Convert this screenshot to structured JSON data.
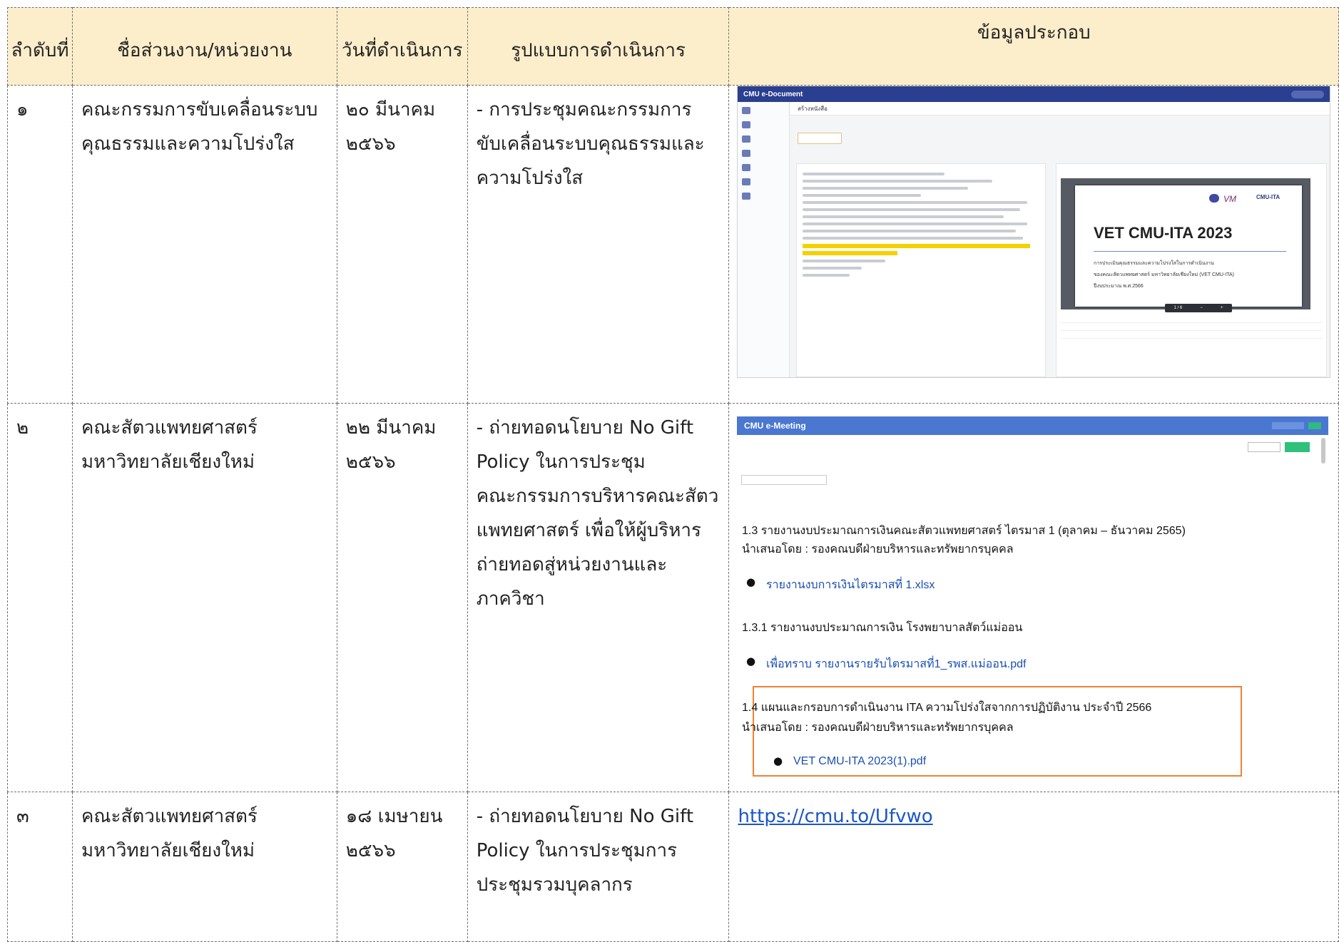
{
  "table": {
    "headers": {
      "no": "ลำดับที่",
      "unit": "ชื่อส่วนงาน/หน่วยงาน",
      "date": "วันที่ดำเนินการ",
      "format": "รูปแบบการดำเนินการ",
      "evidence": "ข้อมูลประกอบ"
    },
    "rows": [
      {
        "no": "๑",
        "unit_line1": "คณะกรรมการขับเคลื่อนระบบ",
        "unit_line2": "คุณธรรมและความโปร่งใส",
        "date_line1": "๒๐ มีนาคม",
        "date_line2": "๒๕๖๖",
        "format_lines": [
          "- การประชุมคณะกรรมการ",
          "ขับเคลื่อนระบบคุณธรรมและ",
          "ความโปร่งใส"
        ]
      },
      {
        "no": "๒",
        "unit_line1": "คณะสัตวแพทยศาสตร์",
        "unit_line2": "มหาวิทยาลัยเชียงใหม่",
        "date_line1": "๒๒ มีนาคม",
        "date_line2": "๒๕๖๖",
        "format_lines": [
          "- ถ่ายทอดนโยบาย No Gift",
          "Policy ในการประชุม",
          "คณะกรรมการบริหารคณะสัตว",
          "แพทยศาสตร์ เพื่อให้ผู้บริหาร",
          "ถ่ายทอดสู่หน่วยงานและ",
          "ภาควิชา"
        ]
      },
      {
        "no": "๓",
        "unit_line1": "คณะสัตวแพทยศาสตร์",
        "unit_line2": "มหาวิทยาลัยเชียงใหม่",
        "date_line1": "๑๘ เมษายน",
        "date_line2": "๒๕๖๖",
        "format_lines": [
          "- ถ่ายทอดนโยบาย No Gift",
          "Policy ในการประชุมการ",
          "ประชุมรวมบุคลากร"
        ],
        "link": "https://cmu.to/Ufvwo"
      }
    ]
  },
  "edoc": {
    "app_title": "CMU e-Document",
    "create_button": "สร้างหนังสือ",
    "viewer_title": "VET CMU-ITA 2023",
    "viewer_desc1": "การประเมินคุณธรรมและความโปร่งใสในการดำเนินงาน",
    "viewer_desc2": "ของคณะสัตวแพทยศาสตร์ มหาวิทยาลัยเชียงใหม่ (VET CMU-ITA)",
    "viewer_desc3": "ปีงบประมาณ พ.ศ.2566",
    "logo_text": "CMU-ITA"
  },
  "emeeting": {
    "app_title": "CMU e-Meeting",
    "item_13_line1": "1.3 รายงานงบประมาณการเงินคณะสัตวแพทยศาสตร์ ไตรมาส 1 (ตุลาคม – ธันวาคม 2565)",
    "item_13_line2": "นำเสนอโดย : รองคณบดีฝ่ายบริหารและทรัพยากรบุคคล",
    "item_13_file": "รายงานงบการเงินไตรมาสที่ 1.xlsx",
    "item_131_line1": "1.3.1 รายงานงบประมาณการเงิน โรงพยาบาลสัตว์แม่ออน",
    "item_131_file": "เพื่อทราบ รายงานรายรับไตรมาสที่1_รพส.แม่ออน.pdf",
    "item_14_line1": "1.4 แผนและกรอบการดำเนินงาน ITA ความโปร่งใสจากการปฏิบัติงาน ประจำปี 2566",
    "item_14_line2": "นำเสนอโดย : รองคณบดีฝ่ายบริหารและทรัพยากรบุคคล",
    "item_14_file": "VET CMU-ITA 2023(1).pdf"
  }
}
